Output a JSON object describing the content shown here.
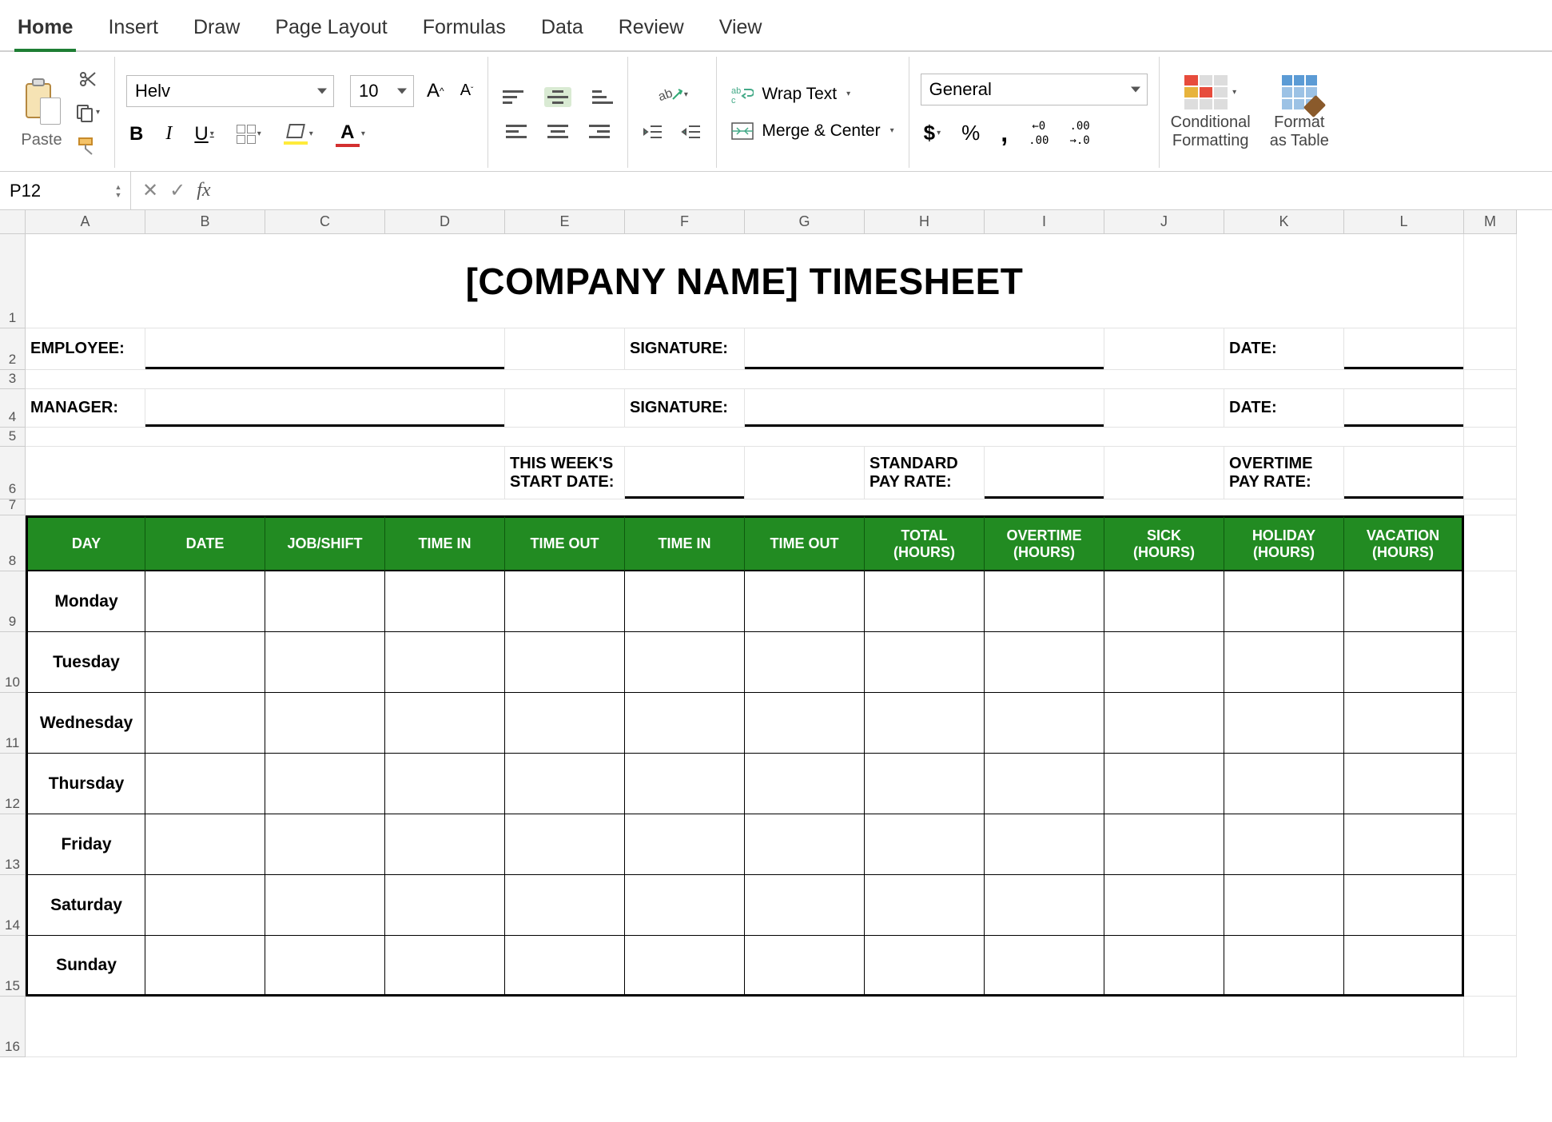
{
  "ribbon": {
    "tabs": [
      "Home",
      "Insert",
      "Draw",
      "Page Layout",
      "Formulas",
      "Data",
      "Review",
      "View"
    ],
    "active_tab": "Home",
    "paste_label": "Paste",
    "font_name": "Helv",
    "font_size": "10",
    "bold": "B",
    "italic": "I",
    "underline": "U",
    "wrap_text": "Wrap Text",
    "merge_center": "Merge & Center",
    "number_format": "General",
    "currency": "$",
    "percent": "%",
    "comma": ",",
    "dec_inc_top": "←0",
    "dec_inc_bot": ".00",
    "dec_dec_top": ".00",
    "dec_dec_bot": "→.0",
    "cond_fmt": "Conditional\nFormatting",
    "fmt_table": "Format\nas Table"
  },
  "formula_bar": {
    "name_box": "P12",
    "cancel": "✕",
    "confirm": "✓",
    "fx": "fx",
    "value": ""
  },
  "columns": [
    "A",
    "B",
    "C",
    "D",
    "E",
    "F",
    "G",
    "H",
    "I",
    "J",
    "K",
    "L",
    "M"
  ],
  "rows_labels": [
    "1",
    "2",
    "3",
    "4",
    "5",
    "6",
    "7",
    "8",
    "9",
    "10",
    "11",
    "12",
    "13",
    "14",
    "15",
    "16"
  ],
  "sheet": {
    "title": "[COMPANY NAME] TIMESHEET",
    "employee_label": "EMPLOYEE:",
    "manager_label": "MANAGER:",
    "signature_label": "SIGNATURE:",
    "date_label": "DATE:",
    "week_start_l1": "THIS WEEK'S",
    "week_start_l2": "START DATE:",
    "std_rate_l1": "STANDARD",
    "std_rate_l2": "PAY RATE:",
    "ot_rate_l1": "OVERTIME",
    "ot_rate_l2": "PAY RATE:",
    "headers": [
      "DAY",
      "DATE",
      "JOB/SHIFT",
      "TIME IN",
      "TIME OUT",
      "TIME IN",
      "TIME OUT",
      "TOTAL\n(HOURS)",
      "OVERTIME\n(HOURS)",
      "SICK\n(HOURS)",
      "HOLIDAY\n(HOURS)",
      "VACATION\n(HOURS)"
    ],
    "days": [
      "Monday",
      "Tuesday",
      "Wednesday",
      "Thursday",
      "Friday",
      "Saturday",
      "Sunday"
    ]
  }
}
